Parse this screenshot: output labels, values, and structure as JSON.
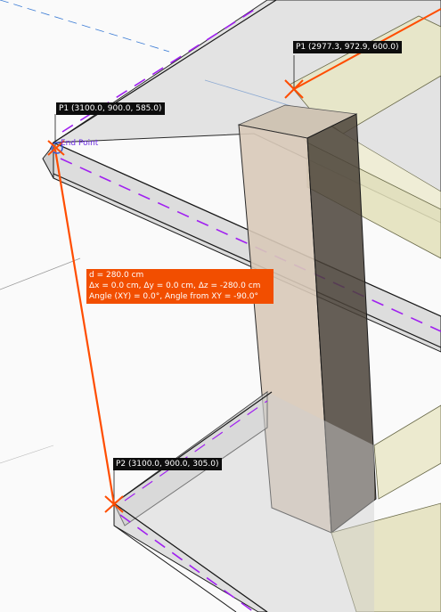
{
  "viewport": {
    "colors": {
      "measure_line": "#ff4d00",
      "measure_box_bg": "#f24e00",
      "guide_dash": "#a020f0",
      "axis_blue": "#3a7bd5",
      "slab_fill": "#bdbdbd",
      "column_light": "#d8c9b8",
      "column_dark": "#4a4238",
      "beam": "#e8e6c4",
      "edge": "#1a1a1a"
    }
  },
  "points": {
    "p1_top": {
      "label": "P1 (2977.3, 972.9, 600.0)"
    },
    "p1_left": {
      "label": "P1 (3100.0, 900.0, 585.0)"
    },
    "p2": {
      "label": "P2 (3100.0, 900.0, 305.0)"
    }
  },
  "snap": {
    "label": "End Point"
  },
  "measurement": {
    "distance": "d = 280.0 cm",
    "deltas": "Δx = 0.0 cm, Δy = 0.0 cm, Δz = -280.0 cm",
    "angles": "Angle (XY) = 0.0°, Angle from XY = -90.0°"
  }
}
